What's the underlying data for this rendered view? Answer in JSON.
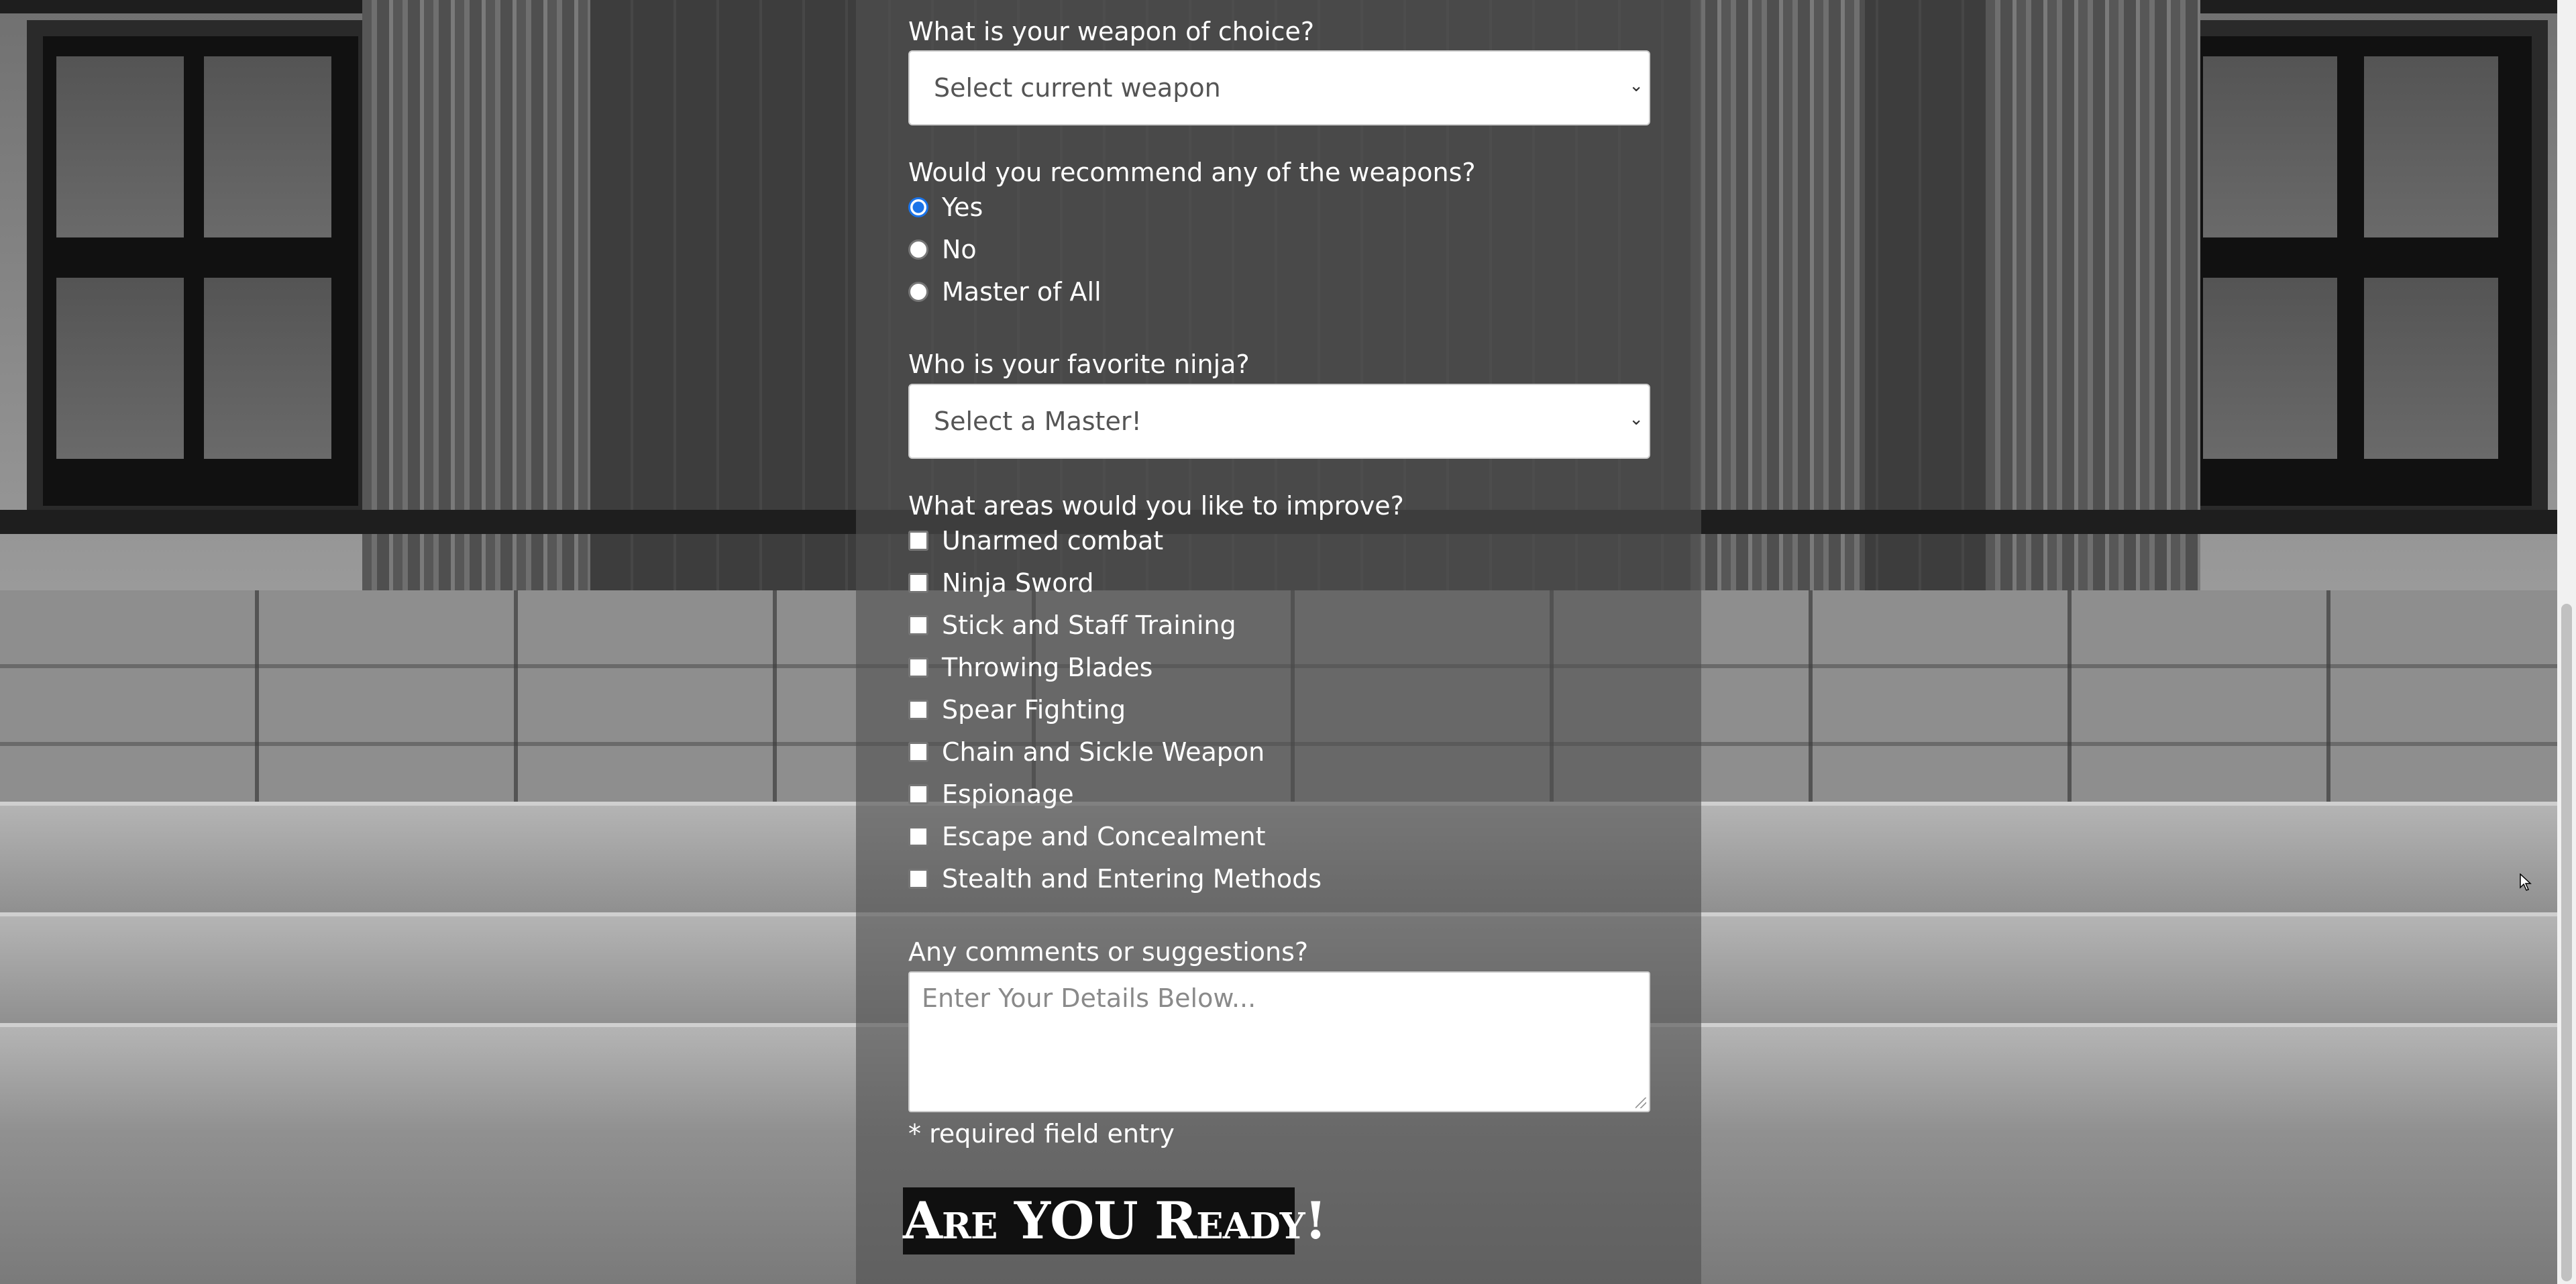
{
  "weapon_question": {
    "label": "What is your weapon of choice?",
    "selected": "Select current weapon"
  },
  "recommend_question": {
    "label": "Would you recommend any of the weapons?",
    "options": [
      {
        "label": "Yes",
        "checked": true
      },
      {
        "label": "No",
        "checked": false
      },
      {
        "label": "Master of All",
        "checked": false
      }
    ]
  },
  "ninja_question": {
    "label": "Who is your favorite ninja?",
    "selected": "Select a Master!"
  },
  "improve_question": {
    "label": "What areas would you like to improve?",
    "options": [
      {
        "label": "Unarmed combat",
        "checked": false
      },
      {
        "label": "Ninja Sword",
        "checked": false
      },
      {
        "label": "Stick and Staff Training",
        "checked": false
      },
      {
        "label": "Throwing Blades",
        "checked": false
      },
      {
        "label": "Spear Fighting",
        "checked": false
      },
      {
        "label": "Chain and Sickle Weapon",
        "checked": false
      },
      {
        "label": "Espionage",
        "checked": false
      },
      {
        "label": "Escape and Concealment",
        "checked": false
      },
      {
        "label": "Stealth and Entering Methods",
        "checked": false
      }
    ]
  },
  "comments_question": {
    "label": "Any comments or suggestions?",
    "placeholder": "Enter Your Details Below..."
  },
  "required_note": "* required field entry",
  "submit_label": "Are YOU Ready!",
  "colors": {
    "radio_accent": "#1a73e8",
    "submit_bg": "#101010",
    "panel_overlay": "rgba(80,80,80,0.62)"
  }
}
